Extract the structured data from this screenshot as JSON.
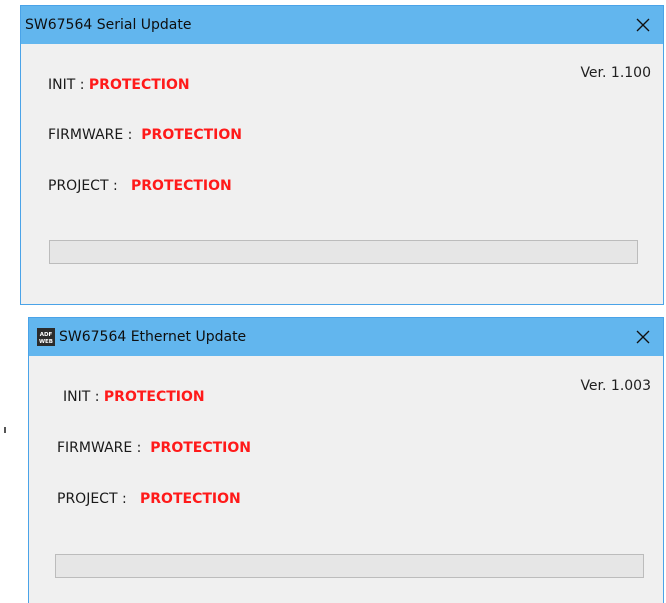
{
  "serial_window": {
    "title": "SW67564 Serial Update",
    "version": "Ver. 1.100",
    "init_label": "INIT : ",
    "init_value": "PROTECTION",
    "firmware_label": "FIRMWARE : ",
    "firmware_value": "PROTECTION",
    "project_label": "PROJECT : ",
    "project_value": "PROTECTION",
    "progress_fraction": 0
  },
  "ethernet_window": {
    "title": "SW67564 Ethernet Update",
    "icon": "adfweb-logo-icon",
    "icon_text_top": "ADF",
    "icon_text_bottom": "WEB",
    "version": "Ver. 1.003",
    "init_label": "INIT : ",
    "init_value": "PROTECTION",
    "firmware_label": "FIRMWARE : ",
    "firmware_value": "PROTECTION",
    "project_label": "PROJECT : ",
    "project_value": "PROTECTION",
    "progress_fraction": 0
  },
  "colors": {
    "titlebar": "#62b6ee",
    "window_border": "#4aa3e8",
    "status_value": "#ff1a1a",
    "window_body": "#f0f0f0"
  }
}
